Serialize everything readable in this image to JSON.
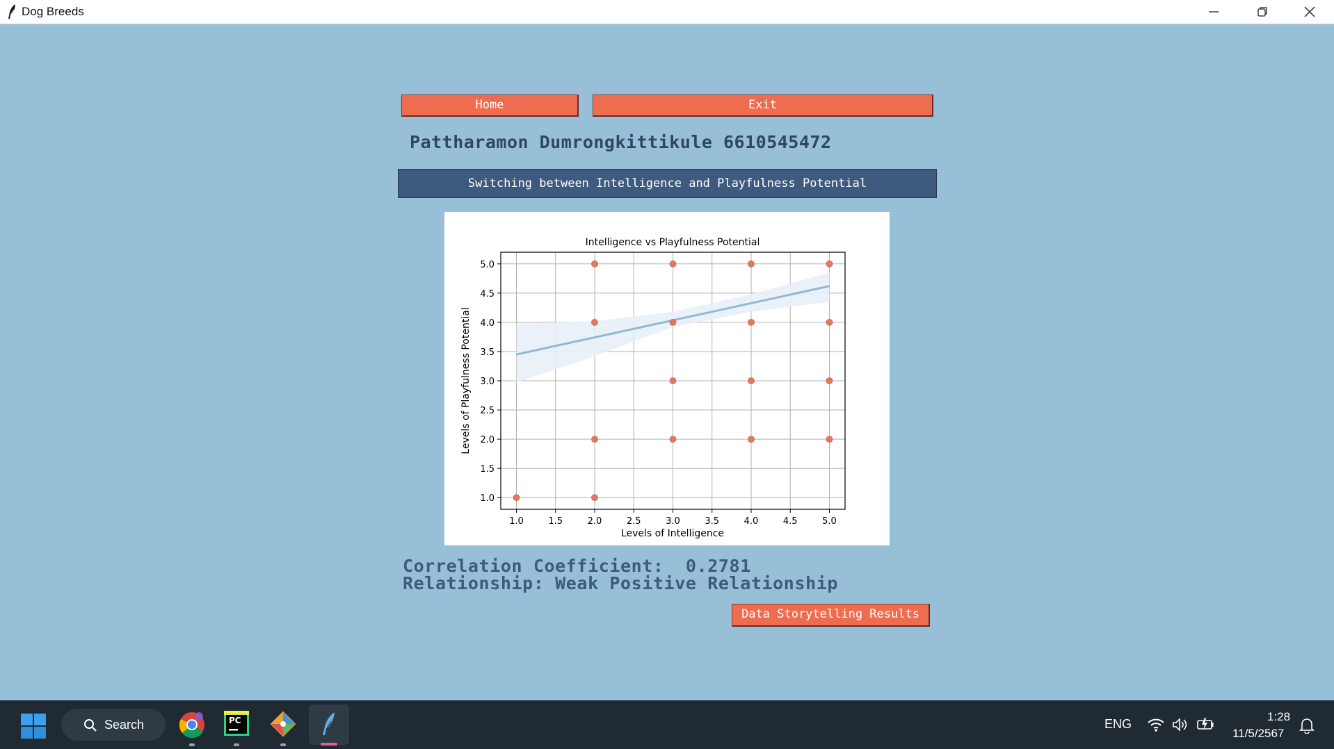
{
  "window": {
    "title": "Dog Breeds",
    "icon": "feather-icon",
    "controls": [
      "minimize-icon",
      "restore-icon",
      "close-icon"
    ]
  },
  "nav": {
    "home_label": "Home",
    "exit_label": "Exit"
  },
  "student_label": "Pattharamon Dumrongkittikule 6610545472",
  "switch_label": "Switching between Intelligence and Playfulness Potential",
  "chart_data": {
    "type": "scatter",
    "title": "Intelligence vs Playfulness Potential",
    "xlabel": "Levels of Intelligence",
    "ylabel": "Levels of Playfulness Potential",
    "xlim": [
      1.0,
      5.0
    ],
    "ylim": [
      1.0,
      5.0
    ],
    "x_ticks": [
      "1.0",
      "1.5",
      "2.0",
      "2.5",
      "3.0",
      "3.5",
      "4.0",
      "4.5",
      "5.0"
    ],
    "y_ticks": [
      "1.0",
      "1.5",
      "2.0",
      "2.5",
      "3.0",
      "3.5",
      "4.0",
      "4.5",
      "5.0"
    ],
    "grid": true,
    "points": [
      {
        "x": 1,
        "y": 1
      },
      {
        "x": 2,
        "y": 1
      },
      {
        "x": 2,
        "y": 2
      },
      {
        "x": 2,
        "y": 4
      },
      {
        "x": 2,
        "y": 5
      },
      {
        "x": 3,
        "y": 2
      },
      {
        "x": 3,
        "y": 3
      },
      {
        "x": 3,
        "y": 4
      },
      {
        "x": 3,
        "y": 5
      },
      {
        "x": 4,
        "y": 2
      },
      {
        "x": 4,
        "y": 3
      },
      {
        "x": 4,
        "y": 4
      },
      {
        "x": 4,
        "y": 5
      },
      {
        "x": 5,
        "y": 2
      },
      {
        "x": 5,
        "y": 3
      },
      {
        "x": 5,
        "y": 4
      },
      {
        "x": 5,
        "y": 5
      }
    ],
    "regression_line": {
      "x": [
        1.0,
        5.0
      ],
      "y": [
        3.45,
        4.62
      ]
    },
    "confidence_band": {
      "x": [
        1.0,
        2.0,
        3.0,
        4.0,
        5.0
      ],
      "upper": [
        3.98,
        4.02,
        4.18,
        4.48,
        4.85
      ],
      "lower": [
        2.97,
        3.42,
        3.92,
        4.18,
        4.35
      ]
    },
    "colors": {
      "points": "#e07a5f",
      "line": "#8fb8d6",
      "band": "#e8f0f7"
    }
  },
  "results": {
    "correlation_line": "Correlation Coefficient:  0.2781",
    "relationship_line": "Relationship: Weak Positive Relationship"
  },
  "storytelling_label": "Data Storytelling Results",
  "taskbar": {
    "search_label": "Search",
    "language": "ENG",
    "time": "1:28",
    "date": "11/5/2567",
    "apps": [
      "chrome-icon",
      "pycharm-icon",
      "git-icon",
      "feather-icon"
    ]
  }
}
